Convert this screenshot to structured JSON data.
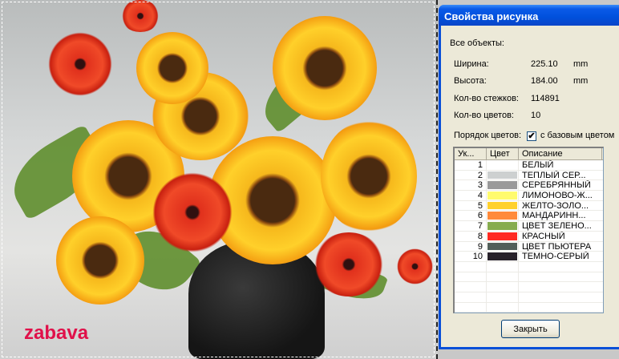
{
  "canvas": {
    "logo_text": "zabava"
  },
  "dialog": {
    "title": "Свойства рисунка",
    "all_objects": "Все объекты:",
    "width_label": "Ширина:",
    "width_value": "225.10",
    "width_unit": "mm",
    "height_label": "Высота:",
    "height_value": "184.00",
    "height_unit": "mm",
    "stitches_label": "Кол-во стежков:",
    "stitches_value": "114891",
    "colors_label": "Кол-во цветов:",
    "colors_value": "10",
    "order_label": "Порядок цветов:",
    "order_checked": true,
    "order_check_mark": "✔",
    "order_option": "с базовым цветом",
    "columns": [
      "Ук...",
      "Цвет",
      "Описание"
    ],
    "rows": [
      {
        "n": "1",
        "color": "#ffffff",
        "desc": "БЕЛЫЙ"
      },
      {
        "n": "2",
        "color": "#cdd0d0",
        "desc": "ТЕПЛЫЙ СЕР..."
      },
      {
        "n": "3",
        "color": "#9a9a9a",
        "desc": "СЕРЕБРЯННЫЙ"
      },
      {
        "n": "4",
        "color": "#fffb6e",
        "desc": "ЛИМОНОВО-Ж..."
      },
      {
        "n": "5",
        "color": "#ffd12e",
        "desc": "ЖЕЛТО-ЗОЛО..."
      },
      {
        "n": "6",
        "color": "#ff8a3a",
        "desc": "МАНДАРИНН..."
      },
      {
        "n": "7",
        "color": "#86ac4e",
        "desc": "ЦВЕТ ЗЕЛЕНО..."
      },
      {
        "n": "8",
        "color": "#ff2a22",
        "desc": "КРАСНЫЙ"
      },
      {
        "n": "9",
        "color": "#525f5a",
        "desc": "ЦВЕТ ПЬЮТЕРА"
      },
      {
        "n": "10",
        "color": "#28222a",
        "desc": "ТЕМНО-СЕРЫЙ"
      }
    ],
    "close_label": "Закрыть"
  }
}
